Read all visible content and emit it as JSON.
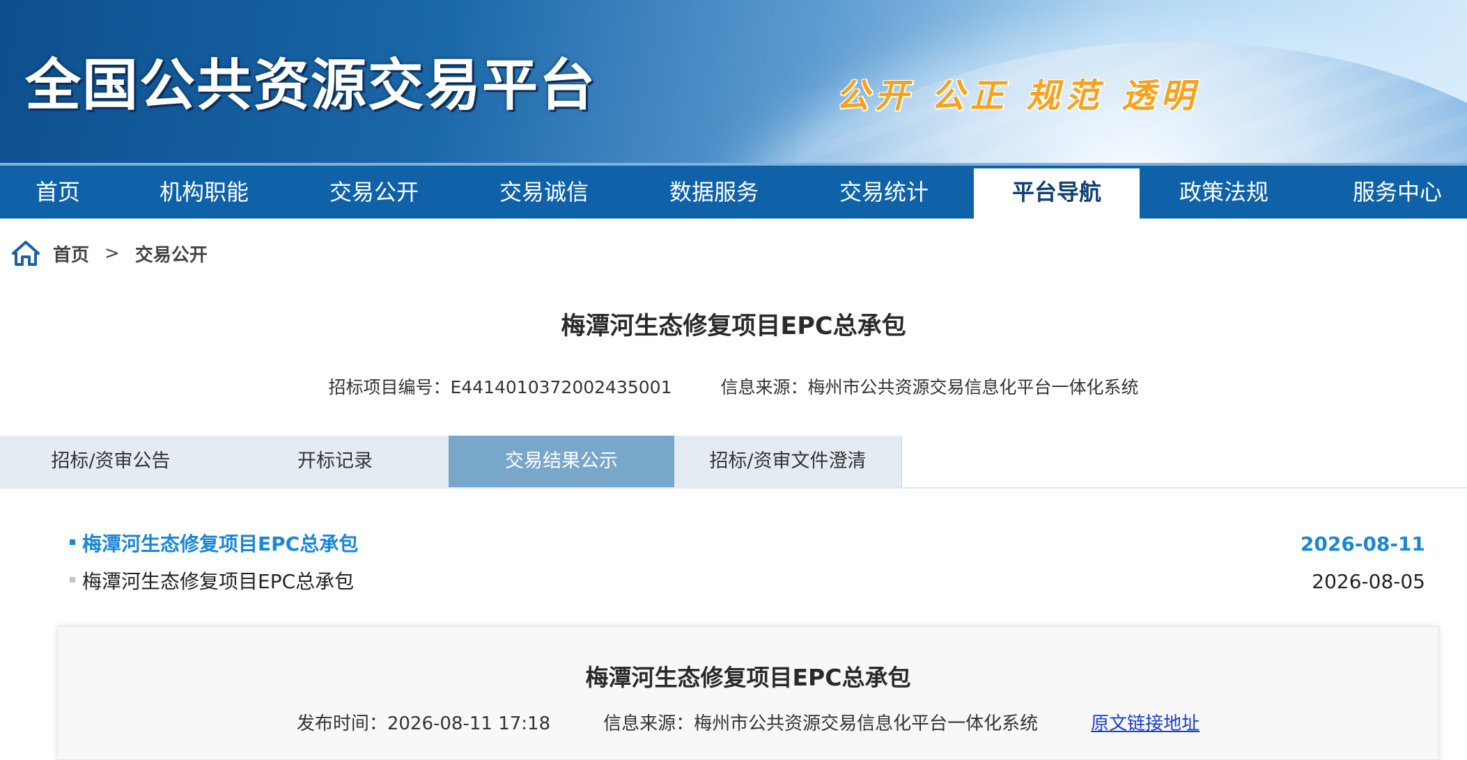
{
  "header": {
    "site_title": "全国公共资源交易平台",
    "slogan": "公开 公正 规范 透明"
  },
  "nav": {
    "items": [
      {
        "label": "首页"
      },
      {
        "label": "机构职能"
      },
      {
        "label": "交易公开"
      },
      {
        "label": "交易诚信"
      },
      {
        "label": "数据服务"
      },
      {
        "label": "交易统计"
      },
      {
        "label": "平台导航",
        "active": true
      },
      {
        "label": "政策法规"
      },
      {
        "label": "服务中心"
      }
    ]
  },
  "breadcrumb": {
    "icon": "home-icon",
    "items": [
      "首页",
      "交易公开"
    ],
    "separator": ">"
  },
  "project": {
    "title": "梅潭河生态修复项目EPC总承包",
    "code_text": "招标项目编号：E4414010372002435001",
    "source_text": "信息来源：梅州市公共资源交易信息化平台一体化系统"
  },
  "tabs": [
    {
      "label": "招标/资审公告"
    },
    {
      "label": "开标记录"
    },
    {
      "label": "交易结果公示",
      "active": true
    },
    {
      "label": "招标/资审文件澄清"
    }
  ],
  "results": [
    {
      "title": "梅潭河生态修复项目EPC总承包",
      "date": "2026-08-11",
      "active": true
    },
    {
      "title": "梅潭河生态修复项目EPC总承包",
      "date": "2026-08-05",
      "active": false
    }
  ],
  "detail": {
    "title": "梅潭河生态修复项目EPC总承包",
    "publish_text": "发布时间：2026-08-11 17:18",
    "source_text": "信息来源：梅州市公共资源交易信息化平台一体化系统",
    "link_label": "原文链接地址"
  },
  "colors": {
    "nav_bg": "#0f62a8",
    "active_tab": "#79a7c9",
    "active_link": "#1b87d4",
    "slogan": "#f7a21b"
  }
}
